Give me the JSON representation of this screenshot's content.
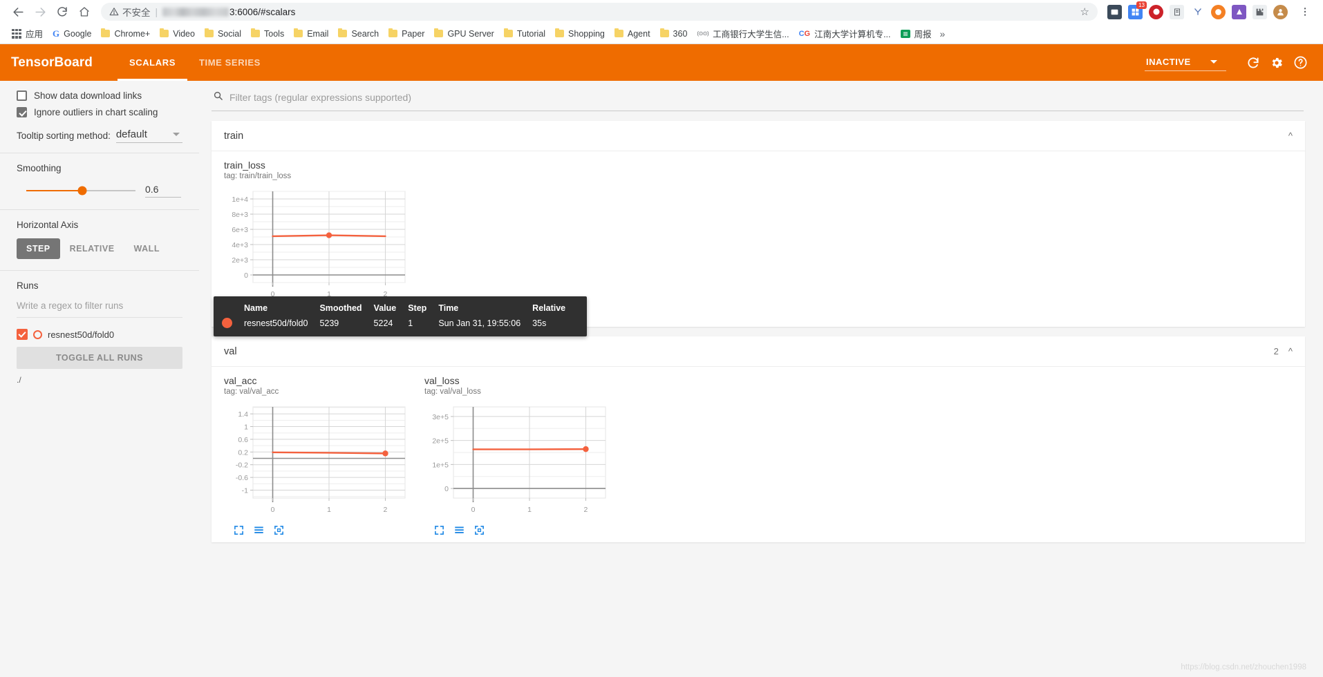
{
  "browser": {
    "nav": {
      "back": "back-arrow",
      "forward": "forward-arrow",
      "reload": "reload",
      "home": "home"
    },
    "omnibox": {
      "insecure_label": "不安全",
      "url_suffix": "3:6006/#scalars",
      "star": "☆"
    },
    "bookmarks": [
      {
        "label": "应用",
        "icon": "apps-grid"
      },
      {
        "label": "Google",
        "icon": "google-g"
      },
      {
        "label": "Chrome+",
        "icon": "folder"
      },
      {
        "label": "Video",
        "icon": "folder"
      },
      {
        "label": "Social",
        "icon": "folder"
      },
      {
        "label": "Tools",
        "icon": "folder"
      },
      {
        "label": "Email",
        "icon": "folder"
      },
      {
        "label": "Search",
        "icon": "folder"
      },
      {
        "label": "Paper",
        "icon": "folder"
      },
      {
        "label": "GPU Server",
        "icon": "folder"
      },
      {
        "label": "Tutorial",
        "icon": "folder"
      },
      {
        "label": "Shopping",
        "icon": "folder"
      },
      {
        "label": "Agent",
        "icon": "folder"
      },
      {
        "label": "360",
        "icon": "folder"
      },
      {
        "label": "工商银行大学生信...",
        "icon": "icbc"
      },
      {
        "label": "江南大学计算机专...",
        "icon": "cg"
      },
      {
        "label": "周报",
        "icon": "sheets"
      }
    ],
    "overflow": "»",
    "extension_badge": "13"
  },
  "tensorboard": {
    "logo": "TensorBoard",
    "tabs": [
      {
        "label": "SCALARS",
        "active": true
      },
      {
        "label": "TIME SERIES",
        "active": false
      }
    ],
    "run_state": "INACTIVE",
    "icons": {
      "reload": "reload-icon",
      "settings": "gear-icon",
      "help": "help-icon"
    },
    "accent_color": "#ef6c00",
    "series_color": "#f4613e"
  },
  "sidebar": {
    "checkboxes": [
      {
        "label": "Show data download links",
        "checked": false
      },
      {
        "label": "Ignore outliers in chart scaling",
        "checked": true
      }
    ],
    "tooltip_sorting": {
      "label": "Tooltip sorting method:",
      "value": "default"
    },
    "smoothing": {
      "title": "Smoothing",
      "value": "0.6",
      "percent": 51
    },
    "horizontal_axis": {
      "title": "Horizontal Axis",
      "options": [
        {
          "label": "STEP",
          "active": true
        },
        {
          "label": "RELATIVE",
          "active": false
        },
        {
          "label": "WALL",
          "active": false
        }
      ]
    },
    "runs": {
      "title": "Runs",
      "filter_placeholder": "Write a regex to filter runs",
      "items": [
        {
          "name": "resnest50d/fold0",
          "checked": true
        }
      ],
      "toggle_all_label": "TOGGLE ALL RUNS",
      "logdir": "./"
    }
  },
  "main": {
    "filter_placeholder": "Filter tags (regular expressions supported)",
    "sections": [
      {
        "name": "train",
        "count": "",
        "expanded": true
      },
      {
        "name": "val",
        "count": "2",
        "expanded": true
      }
    ]
  },
  "tooltip": {
    "headers": [
      "Name",
      "Smoothed",
      "Value",
      "Step",
      "Time",
      "Relative"
    ],
    "row": {
      "name": "resnest50d/fold0",
      "smoothed": "5239",
      "value": "5224",
      "step": "1",
      "time": "Sun Jan 31, 19:55:06",
      "relative": "35s"
    }
  },
  "chart_data": [
    {
      "type": "line",
      "title": "train_loss",
      "tag": "tag: train/train_loss",
      "xlabel": "",
      "ylabel": "",
      "x": [
        0,
        1,
        2
      ],
      "series": [
        {
          "name": "resnest50d/fold0",
          "values": [
            5100,
            5224,
            5100
          ],
          "color": "#f4613e"
        }
      ],
      "xticks": [
        0,
        1,
        2
      ],
      "yticks": [
        "0",
        "2e+3",
        "4e+3",
        "6e+3",
        "8e+3",
        "1e+4"
      ],
      "ytick_values": [
        0,
        2000,
        4000,
        6000,
        8000,
        10000
      ],
      "ylim": [
        -1000,
        11000
      ],
      "xlim": [
        -0.35,
        2.35
      ],
      "grid": true,
      "marker_at": {
        "x": 1,
        "y": 5224
      }
    },
    {
      "type": "line",
      "title": "val_acc",
      "tag": "tag: val/val_acc",
      "xlabel": "",
      "ylabel": "",
      "x": [
        0,
        1,
        2
      ],
      "series": [
        {
          "name": "resnest50d/fold0",
          "values": [
            0.19,
            0.175,
            0.155
          ],
          "color": "#f4613e"
        }
      ],
      "xticks": [
        0,
        1,
        2
      ],
      "yticks": [
        "-1",
        "-0.6",
        "-0.2",
        "0.2",
        "0.6",
        "1",
        "1.4"
      ],
      "ytick_values": [
        -1,
        -0.6,
        -0.2,
        0.2,
        0.6,
        1,
        1.4
      ],
      "ylim": [
        -1.25,
        1.62
      ],
      "xlim": [
        -0.35,
        2.35
      ],
      "grid": true,
      "marker_at": {
        "x": 2,
        "y": 0.155
      }
    },
    {
      "type": "line",
      "title": "val_loss",
      "tag": "tag: val/val_loss",
      "xlabel": "",
      "ylabel": "",
      "x": [
        0,
        1,
        2
      ],
      "series": [
        {
          "name": "resnest50d/fold0",
          "values": [
            163000,
            163000,
            164000
          ],
          "color": "#f4613e"
        }
      ],
      "xticks": [
        0,
        1,
        2
      ],
      "yticks": [
        "0",
        "1e+5",
        "2e+5",
        "3e+5"
      ],
      "ytick_values": [
        0,
        100000,
        200000,
        300000
      ],
      "ylim": [
        -40000,
        340000
      ],
      "xlim": [
        -0.35,
        2.35
      ],
      "grid": true,
      "marker_at": {
        "x": 2,
        "y": 164000
      }
    }
  ],
  "chart_toolbar_icons": [
    "expand-icon",
    "data-table-icon",
    "reset-zoom-icon"
  ],
  "watermark": "https://blog.csdn.net/zhouchen1998"
}
